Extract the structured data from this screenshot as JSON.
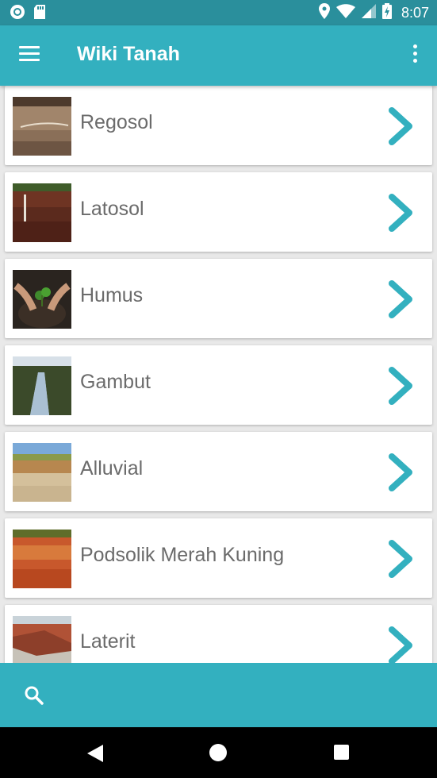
{
  "status_bar": {
    "time": "8:07"
  },
  "app_bar": {
    "title": "Wiki Tanah"
  },
  "soils": [
    {
      "label": "Regosol"
    },
    {
      "label": "Latosol"
    },
    {
      "label": "Humus"
    },
    {
      "label": "Gambut"
    },
    {
      "label": "Alluvial"
    },
    {
      "label": "Podsolik Merah Kuning"
    },
    {
      "label": "Laterit"
    }
  ],
  "colors": {
    "primary": "#33b0bf",
    "primary_dark": "#2a8f9c",
    "chevron": "#33b0bf",
    "text": "#6b6b6b"
  },
  "icons": {
    "menu": "hamburger-menu-icon",
    "more": "more-vert-icon",
    "chevron": "chevron-right-icon",
    "search": "search-icon"
  }
}
